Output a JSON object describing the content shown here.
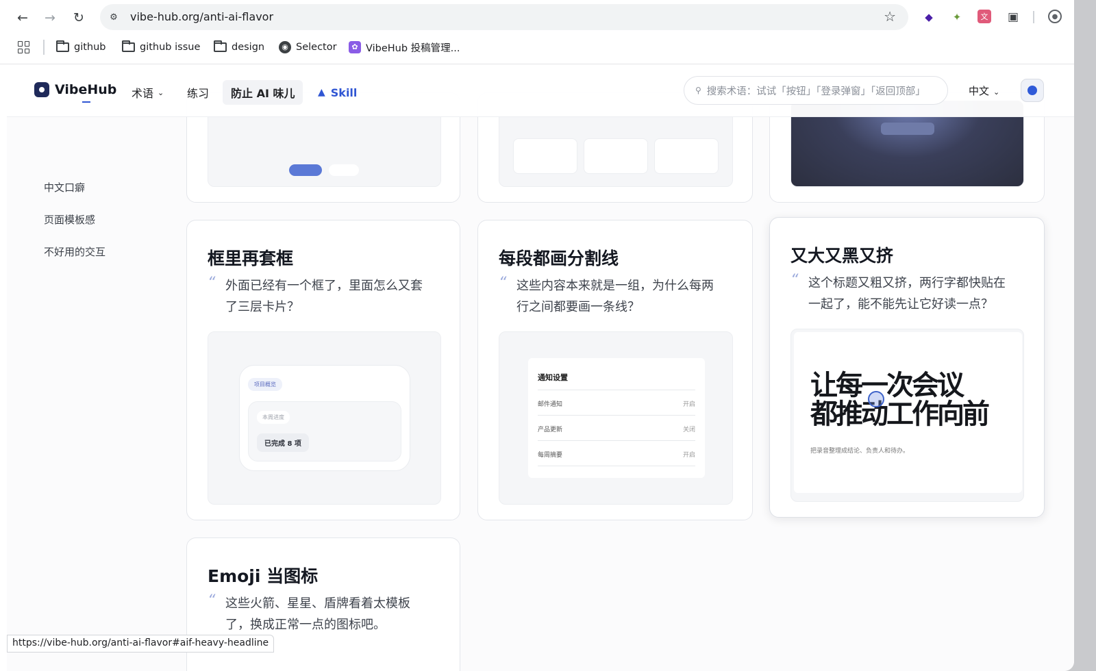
{
  "browser": {
    "url": "vibe-hub.org/anti-ai-flavor",
    "status_url": "https://vibe-hub.org/anti-ai-flavor#aif-heavy-headline",
    "bookmarks": [
      "github",
      "github issue",
      "design",
      "Selector",
      "VibeHub 投稿管理..."
    ]
  },
  "site": {
    "logo": "VibeHub",
    "nav": {
      "terms": "术语",
      "practice": "练习",
      "anti_ai": "防止 AI 味儿",
      "skill": "Skill"
    },
    "search_placeholder": "搜索术语：试试「按钮」「登录弹窗」「返回顶部」",
    "lang": "中文"
  },
  "toc": [
    "中文口癖",
    "页面模板感",
    "不好用的交互"
  ],
  "cards": {
    "nested": {
      "title": "框里再套框",
      "quote_lines": [
        "外面已经有一个框了，里面怎么又套",
        "了三层卡片？"
      ],
      "preview": {
        "outer_tag": "项目概览",
        "inner_tag": "本周进度",
        "result": "已完成 8 项"
      }
    },
    "divider": {
      "title": "每段都画分割线",
      "quote_lines": [
        "这些内容本来就是一组，为什么每两",
        "行之间都要画一条线？"
      ],
      "preview": {
        "title": "通知设置",
        "rows": [
          {
            "label": "邮件通知",
            "value": "开启"
          },
          {
            "label": "产品更新",
            "value": "关闭"
          },
          {
            "label": "每周摘要",
            "value": "开启"
          }
        ]
      }
    },
    "headline": {
      "title": "又大又黑又挤",
      "quote_lines": [
        "这个标题又粗又挤，两行字都快贴在",
        "一起了，能不能先让它好读一点？"
      ],
      "preview": {
        "line1": "让每一次会议",
        "line2": "都推动工作向前",
        "sub": "把录音整理成结论、负责人和待办。"
      }
    },
    "emoji": {
      "title": "Emoji 当图标",
      "quote_lines": [
        "这些火箭、星星、盾牌看着太模板",
        "了，换成正常一点的图标吧。"
      ]
    }
  }
}
